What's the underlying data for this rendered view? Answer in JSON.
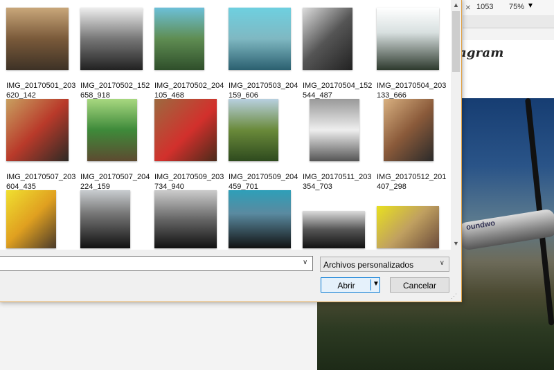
{
  "browser": {
    "close_glyph": "×",
    "width_value": "1053",
    "zoom": "75%",
    "zoom_caret": "▼",
    "site_logo_text": "agram",
    "photo_tube_text": "oundwo"
  },
  "dialog": {
    "files": [
      {
        "name": "IMG_20170501_203620_142"
      },
      {
        "name": "IMG_20170502_152658_918"
      },
      {
        "name": "IMG_20170502_204105_468"
      },
      {
        "name": "IMG_20170503_204159_606"
      },
      {
        "name": "IMG_20170504_152544_487"
      },
      {
        "name": "IMG_20170504_203133_666"
      },
      {
        "name": "IMG_20170507_203604_435"
      },
      {
        "name": "IMG_20170507_204224_159"
      },
      {
        "name": "IMG_20170509_203734_940"
      },
      {
        "name": "IMG_20170509_204459_701"
      },
      {
        "name": "IMG_20170511_203354_703"
      },
      {
        "name": "IMG_20170512_201407_298"
      },
      {
        "name": ""
      },
      {
        "name": ""
      },
      {
        "name": ""
      },
      {
        "name": ""
      },
      {
        "name": ""
      },
      {
        "name": ""
      }
    ],
    "filename_value": "",
    "filetype_selected": "Archivos personalizados",
    "open_label": "Abrir",
    "cancel_label": "Cancelar"
  }
}
